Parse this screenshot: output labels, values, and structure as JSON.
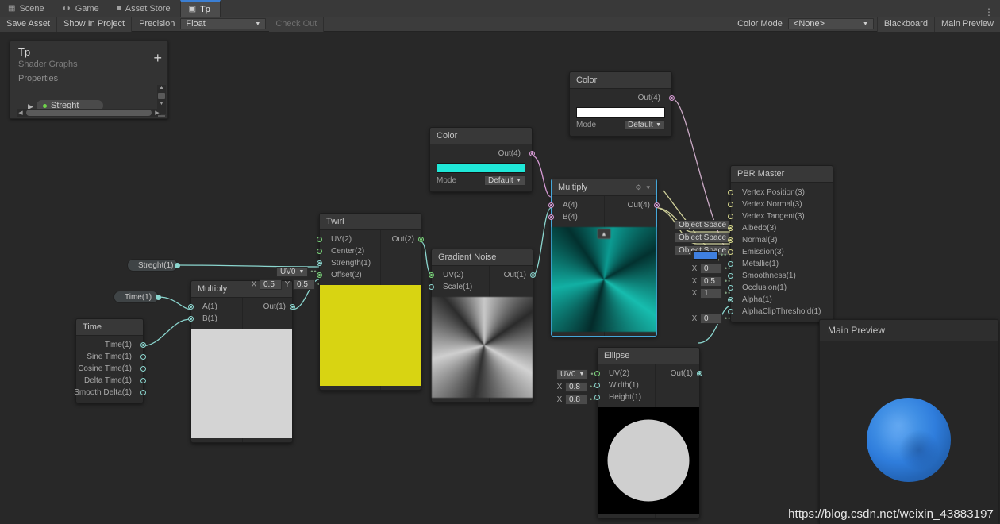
{
  "tabs": [
    {
      "label": "Scene",
      "icon": "grid-icon",
      "active": false
    },
    {
      "label": "Game",
      "icon": "gamepad-icon",
      "active": false
    },
    {
      "label": "Asset Store",
      "icon": "store-icon",
      "active": false
    },
    {
      "label": "Tp",
      "icon": "shadergraph-icon",
      "active": true
    }
  ],
  "toolbar": {
    "save_asset": "Save Asset",
    "show_in_project": "Show In Project",
    "precision_label": "Precision",
    "precision_value": "Float",
    "check_out": "Check Out",
    "color_mode_label": "Color Mode",
    "color_mode_value": "<None>",
    "blackboard": "Blackboard",
    "main_preview": "Main Preview",
    "kebab": "⋮"
  },
  "blackboard": {
    "title": "Tp",
    "subtitle": "Shader Graphs",
    "add_label": "+",
    "section": "Properties",
    "property": "Streght"
  },
  "nodes": {
    "color_top": {
      "title": "Color",
      "out": "Out(4)",
      "mode_label": "Mode",
      "mode_value": "Default",
      "swatch_color": "#ffffff"
    },
    "color_mid": {
      "title": "Color",
      "out": "Out(4)",
      "mode_label": "Mode",
      "mode_value": "Default",
      "swatch_color": "#1fe8d8"
    },
    "multiply_rgb": {
      "title": "Multiply",
      "inputs": [
        "A(4)",
        "B(4)"
      ],
      "out": "Out(4)",
      "selected": true
    },
    "twirl": {
      "title": "Twirl",
      "inputs": [
        "UV(2)",
        "Center(2)",
        "Strength(1)",
        "Offset(2)"
      ],
      "out": "Out(2)",
      "uv_dropdown": "UV0",
      "center_x_axis": "X",
      "center_x": "0.5",
      "center_y_axis": "Y",
      "center_y": "0.5"
    },
    "gradient_noise": {
      "title": "Gradient Noise",
      "inputs": [
        "UV(2)",
        "Scale(1)"
      ],
      "out": "Out(1)"
    },
    "multiply_scalar": {
      "title": "Multiply",
      "inputs": [
        "A(1)",
        "B(1)"
      ],
      "out": "Out(1)"
    },
    "time": {
      "title": "Time",
      "outputs": [
        "Time(1)",
        "Sine Time(1)",
        "Cosine Time(1)",
        "Delta Time(1)",
        "Smooth Delta(1)"
      ]
    },
    "ellipse": {
      "title": "Ellipse",
      "inputs": [
        "UV(2)",
        "Width(1)",
        "Height(1)"
      ],
      "out": "Out(1)",
      "uv_dropdown": "UV0",
      "width_axis": "X",
      "width": "0.8",
      "height_axis": "X",
      "height": "0.8"
    },
    "pbr_master": {
      "title": "PBR Master",
      "slots": [
        {
          "label": "Vertex Position(3)",
          "control": "Object Space",
          "type": "dropdown"
        },
        {
          "label": "Vertex Normal(3)",
          "control": "Object Space",
          "type": "dropdown"
        },
        {
          "label": "Vertex Tangent(3)",
          "control": "Object Space",
          "type": "dropdown"
        },
        {
          "label": "Albedo(3)",
          "control": "",
          "type": "connected"
        },
        {
          "label": "Normal(3)",
          "control": "",
          "type": "connected"
        },
        {
          "label": "Emission(3)",
          "control": "#3f7fe0",
          "type": "color"
        },
        {
          "label": "Metallic(1)",
          "control": "0",
          "axis": "X",
          "type": "float"
        },
        {
          "label": "Smoothness(1)",
          "control": "0.5",
          "axis": "X",
          "type": "float"
        },
        {
          "label": "Occlusion(1)",
          "control": "1",
          "axis": "X",
          "type": "float"
        },
        {
          "label": "Alpha(1)",
          "control": "",
          "type": "connected"
        },
        {
          "label": "AlphaClipThreshold(1)",
          "control": "0",
          "axis": "X",
          "type": "float"
        }
      ]
    }
  },
  "property_nodes": [
    {
      "label": "Streght(1)"
    },
    {
      "label": "Time(1)"
    }
  ],
  "main_preview": {
    "title": "Main Preview"
  },
  "watermark": "https://blog.csdn.net/weixin_43883197",
  "colors": {
    "accent_blue": "#3b7fd4",
    "port_teal": "#8bd6cf",
    "port_green": "#7ad47a",
    "port_pink": "#d69ad4",
    "port_yellow": "#d7d88b",
    "canvas_bg": "#282828"
  }
}
